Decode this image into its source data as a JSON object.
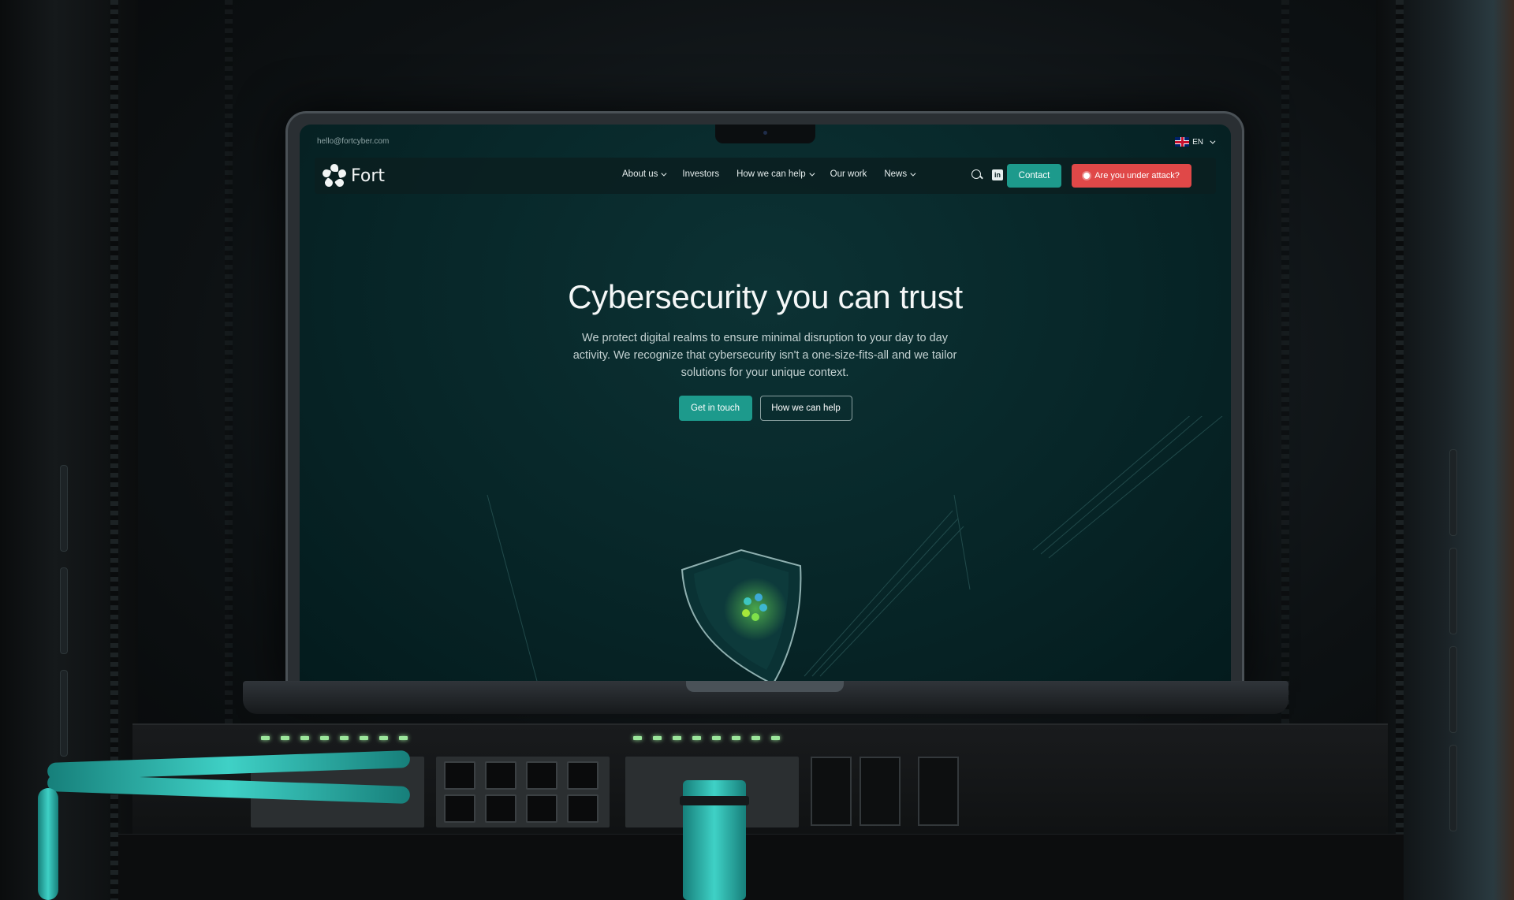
{
  "topbar": {
    "email": "hello@fortcyber.com",
    "language": "EN"
  },
  "nav": {
    "brand": "Fort",
    "links": [
      {
        "label": "About us",
        "has_dropdown": true
      },
      {
        "label": "Investors",
        "has_dropdown": false
      },
      {
        "label": "How we can help",
        "has_dropdown": true
      },
      {
        "label": "Our work",
        "has_dropdown": false
      },
      {
        "label": "News",
        "has_dropdown": true
      }
    ],
    "linkedin_icon_text": "in",
    "contact_label": "Contact",
    "attack_label": "Are you under attack?"
  },
  "hero": {
    "title": "Cybersecurity you can trust",
    "subtitle": "We protect digital realms to ensure minimal disruption to your day to day activity. We recognize that cybersecurity isn't a one-size-fits-all and we tailor solutions for your unique context.",
    "primary_button": "Get in touch",
    "secondary_button": "How we can help"
  },
  "colors": {
    "accent": "#1d9a8c",
    "alert": "#e04848",
    "screen_bg": "#072628",
    "cable": "#3fd1c6",
    "led": "#9be69b"
  },
  "icons": [
    "search-icon",
    "linkedin-icon",
    "chevron-down-icon",
    "uk-flag-icon",
    "shield-icon",
    "alert-dot-icon"
  ]
}
